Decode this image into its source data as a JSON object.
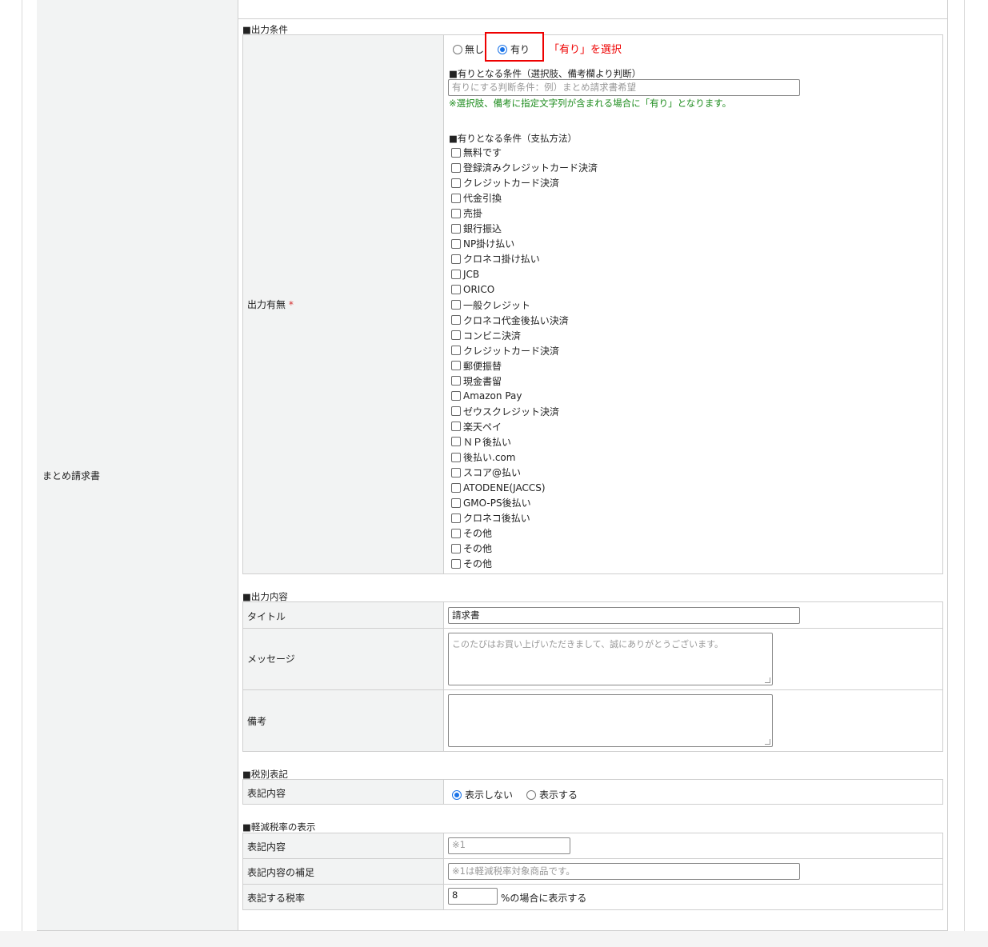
{
  "row_label": "まとめ請求書",
  "output_condition": {
    "section_title": "■出力条件",
    "field_label": "出力有無",
    "required_mark": "*",
    "radio_none": "無し",
    "radio_yes": "有り",
    "annotation": "「有り」を選択",
    "condition_remarks_title": "■有りとなる条件（選択肢、備考欄より判断）",
    "condition_remarks_placeholder": "有りにする判断条件：例）まとめ請求書希望",
    "condition_note": "※選択肢、備考に指定文字列が含まれる場合に「有り」となります。",
    "payment_title": "■有りとなる条件（支払方法）",
    "payment_methods": [
      "無料です",
      "登録済みクレジットカード決済",
      "クレジットカード決済",
      "代金引換",
      "売掛",
      "銀行振込",
      "NP掛け払い",
      "クロネコ掛け払い",
      "JCB",
      "ORICO",
      "一般クレジット",
      "クロネコ代金後払い決済",
      "コンビニ決済",
      "クレジットカード決済",
      "郵便振替",
      "現金書留",
      "Amazon Pay",
      "ゼウスクレジット決済",
      "楽天ペイ",
      "ＮＰ後払い",
      "後払い.com",
      "スコア@払い",
      "ATODENE(JACCS)",
      "GMO-PS後払い",
      "クロネコ後払い",
      "その他",
      "その他",
      "その他"
    ]
  },
  "output_content": {
    "section_title": "■出力内容",
    "title_label": "タイトル",
    "title_value": "請求書",
    "message_label": "メッセージ",
    "message_placeholder": "このたびはお買い上げいただきまして、誠にありがとうございます。",
    "remarks_label": "備考"
  },
  "tax_display": {
    "section_title": "■税別表記",
    "label": "表記内容",
    "option_hide": "表示しない",
    "option_show": "表示する"
  },
  "reduced_tax": {
    "section_title": "■軽減税率の表示",
    "content_label": "表記内容",
    "content_placeholder": "※1",
    "supplement_label": "表記内容の補足",
    "supplement_placeholder": "※1は軽減税率対象商品です。",
    "rate_label": "表記する税率",
    "rate_value": "8",
    "rate_suffix": "%の場合に表示する"
  },
  "colors": {
    "accent": "#1a73e8",
    "annotation_red": "#ee0000",
    "note_green": "#1e8c1e",
    "header_bg": "#f2f3f3"
  }
}
